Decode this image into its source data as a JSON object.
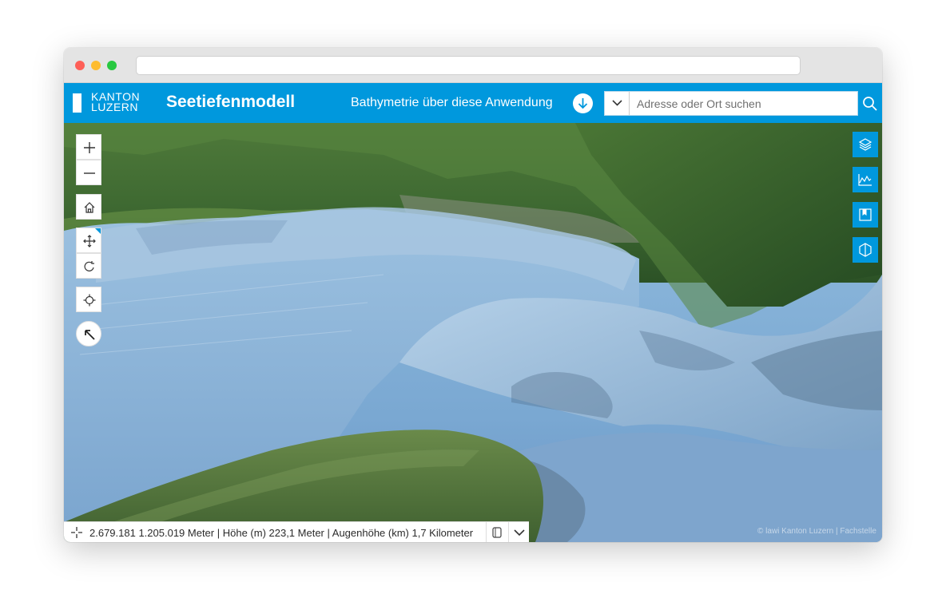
{
  "browser": {
    "url": ""
  },
  "header": {
    "logo_line1": "KANTON",
    "logo_line2": "LUZERN",
    "title": "Seetiefenmodell",
    "subtitle_link": "Bathymetrie über diese Anwendung",
    "download_icon": "download-arrow-icon",
    "accent_color": "#0098dd"
  },
  "search": {
    "placeholder": "Adresse oder Ort suchen",
    "value": "",
    "dropdown_icon": "chevron-down-icon",
    "button_icon": "search-icon"
  },
  "map_controls": {
    "zoom_in_icon": "plus-icon",
    "zoom_out_icon": "minus-icon",
    "home_icon": "home-icon",
    "pan_icon": "move-icon",
    "rotate_icon": "rotate-icon",
    "locate_icon": "locate-icon",
    "compass_icon": "compass-arrow-icon"
  },
  "right_toolbar": [
    {
      "icon": "layers-icon"
    },
    {
      "icon": "elevation-profile-icon"
    },
    {
      "icon": "bookmark-icon"
    },
    {
      "icon": "slice-icon"
    }
  ],
  "coordinate_bar": {
    "text": "2.679.181 1.205.019 Meter | Höhe (m) 223,1 Meter | Augenhöhe (km) 1,7 Kilometer",
    "icon": "crosshair-icon",
    "copy_icon": "copy-icon",
    "toggle_icon": "chevron-down-icon"
  },
  "attribution": "© lawi Kanton Luzern | Fachstelle"
}
